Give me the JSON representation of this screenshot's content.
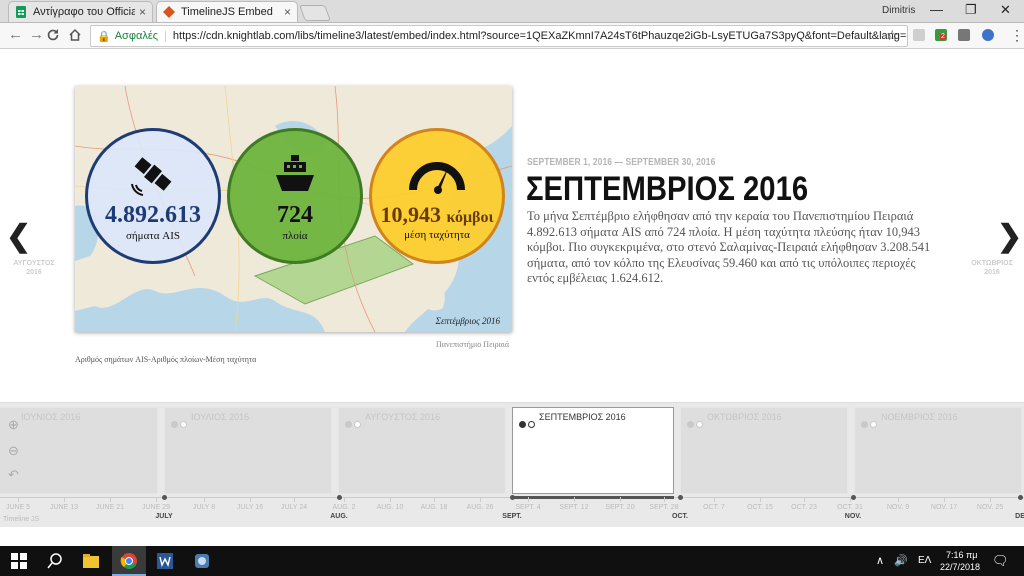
{
  "browser": {
    "tabs": [
      {
        "title": "Αντίγραφο του Official T",
        "close": "×"
      },
      {
        "title": "TimelineJS Embed",
        "close": "×"
      }
    ],
    "user": "Dimitris",
    "secure_label": "Ασφαλές",
    "url": "https://cdn.knightlab.com/libs/timeline3/latest/embed/index.html?source=1QEXaZKmnI7A24sT6tPhauzqe2iGb-LsyETUGa7S3pyQ&font=Default&lang=e...",
    "extension_badge": "2"
  },
  "slide": {
    "stats": [
      {
        "value": "4.892.613",
        "label": "σήματα AIS",
        "icon": "satellite-icon"
      },
      {
        "value": "724",
        "label": "πλοία",
        "icon": "ship-icon"
      },
      {
        "value": "10,943",
        "unit": "κόμβοι",
        "label": "μέση ταχύτητα",
        "icon": "speedometer-icon"
      }
    ],
    "map_caption": "Σεπτέμβριος 2016",
    "credit": "Πανεπιστήμιο Πειραιά",
    "media_caption": "Αριθμός σημάτων AIS-Αριθμός πλοίων-Μέση ταχύτητα",
    "date_range": "SEPTEMBER 1, 2016 — SEPTEMBER 30, 2016",
    "headline": "ΣΕΠΤΕΜΒΡΙΟΣ 2016",
    "text": "Το μήνα Σεπτέμβριο ελήφθησαν από την κεραία του Πανεπιστημίου Πειραιά 4.892.613 σήματα AIS από 724 πλοία. Η μέση ταχύτητα πλεύσης ήταν 10,943 κόμβοι. Πιο συγκεκριμένα, στο στενό Σαλαμίνας-Πειραιά ελήφθησαν 3.208.541 σήματα, από τον κόλπο της Ελευσίνας 59.460 και από τις υπόλοιπες περιοχές εντός εμβέλειας 1.624.612.",
    "prev": {
      "title": "ΑΥΓΟΥΣΤΟΣ",
      "year": "2016"
    },
    "next": {
      "title": "ΟΚΤΩΒΡΙΟΣ",
      "year": "2016"
    }
  },
  "timeline": {
    "events": [
      {
        "title": "ΙΟΥΝΙΟΣ 2016"
      },
      {
        "title": "ΙΟΥΛΙΟΣ 2016"
      },
      {
        "title": "ΑΥΓΟΥΣΤΟΣ 2016"
      },
      {
        "title": "ΣΕΠΤΕΜΒΡΙΟΣ 2016",
        "active": true
      },
      {
        "title": "ΟΚΤΩΒΡΙΟΣ 2016"
      },
      {
        "title": "ΝΟΕΜΒΡΙΟΣ 2016"
      }
    ],
    "date_ticks": [
      "JUNE 5",
      "JUNE 13",
      "JUNE 21",
      "JUNE 29",
      "JULY 8",
      "JULY 16",
      "JULY 24",
      "AUG. 2",
      "AUG. 10",
      "AUG. 18",
      "AUG. 26",
      "SEPT. 4",
      "SEPT. 12",
      "SEPT. 20",
      "SEPT. 28",
      "OCT. 7",
      "OCT. 15",
      "OCT. 23",
      "OCT. 31",
      "NOV. 9",
      "NOV. 17",
      "NOV. 25"
    ],
    "month_ticks": [
      "JULY",
      "AUG.",
      "SEPT.",
      "OCT.",
      "NOV.",
      "DE"
    ],
    "watermark": "Timeline JS"
  },
  "taskbar": {
    "lang": "ΕΛ",
    "time": "7:16 πμ",
    "date": "22/7/2018"
  }
}
